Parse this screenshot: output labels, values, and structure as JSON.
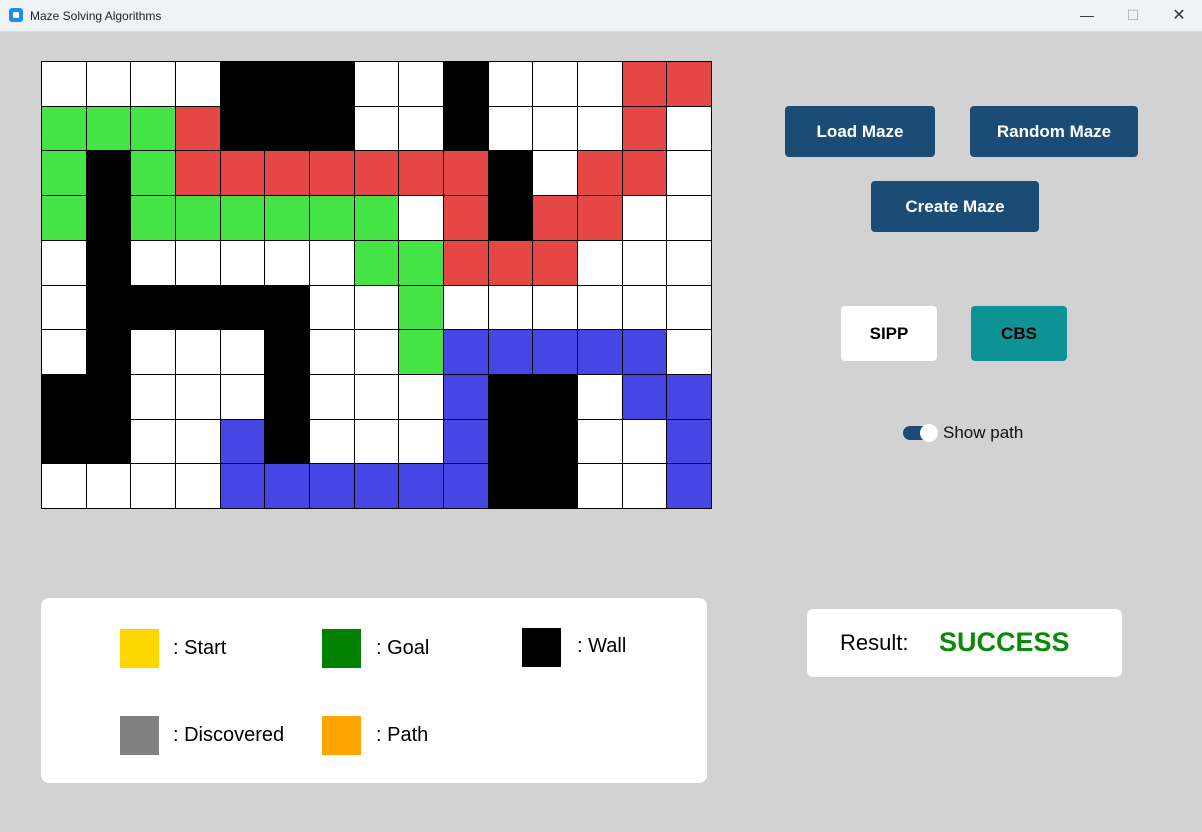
{
  "window": {
    "title": "Maze Solving Algorithms",
    "minimize": "—",
    "maximize": "☐",
    "close": "✕"
  },
  "colors": {
    "W": "#ffffff",
    "K": "#000000",
    "G": "#46e346",
    "R": "#e54646",
    "B": "#4646e5",
    "start": "#ffd700",
    "goal": "#008000",
    "wall": "#000000",
    "discovered": "#808080",
    "path": "#ffa500",
    "success": "#0a8a0a"
  },
  "maze": {
    "rows": 10,
    "cols": 15,
    "grid": [
      "WWWWKKKWWKWWWRR",
      "GGGRKKKWWKWWWRW",
      "GKGRRRRRRRKWRRW",
      "GKGGGGGGWRKRRWW",
      "WKWWWWWGGRRRWWW",
      "WKKKKKWWGWWWWWW",
      "WKWWWKWWGBBBBBW",
      "KKWWWKWWWBKKWBB",
      "KKWWBKWWWBKKWWB",
      "WWWWBBBBBBKKWWB"
    ]
  },
  "controls": {
    "load_maze": "Load Maze",
    "random_maze": "Random Maze",
    "create_maze": "Create Maze",
    "sipp": "SIPP",
    "cbs": "CBS",
    "show_path_label": "Show path",
    "show_path_on": true
  },
  "legend": {
    "start": ": Start",
    "goal": ": Goal",
    "wall": ": Wall",
    "discovered": ": Discovered",
    "path": ": Path"
  },
  "result": {
    "label": "Result:",
    "value": "SUCCESS"
  }
}
